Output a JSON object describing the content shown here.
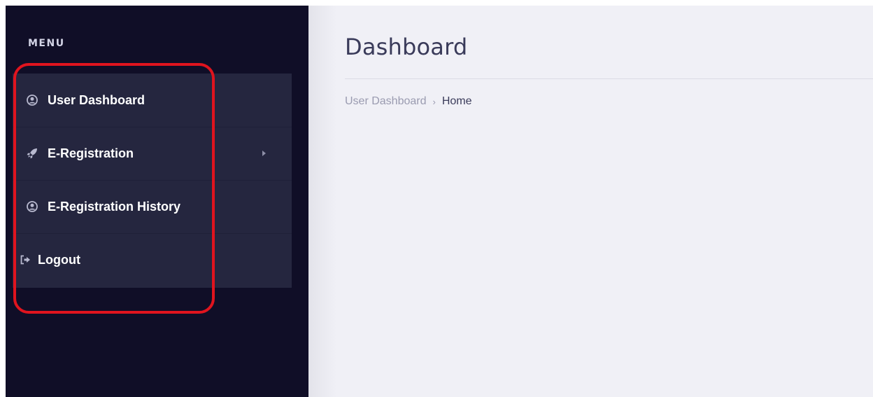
{
  "sidebar": {
    "menu_heading": "MENU",
    "items": [
      {
        "label": "User Dashboard",
        "icon": "user-circle-icon"
      },
      {
        "label": "E-Registration",
        "icon": "rocket-icon",
        "has_submenu": true
      },
      {
        "label": "E-Registration History",
        "icon": "user-circle-icon"
      },
      {
        "label": "Logout",
        "icon": "sign-out-icon"
      }
    ]
  },
  "main": {
    "title": "Dashboard",
    "breadcrumb": {
      "link": "User Dashboard",
      "separator": "›",
      "current": "Home"
    }
  },
  "colors": {
    "sidebar_bg": "#100e27",
    "menu_panel_bg": "#25263f",
    "main_bg": "#f0f0f6",
    "highlight": "#e0141e",
    "title_text": "#3a3b5a",
    "icon": "#b8b9cf"
  }
}
